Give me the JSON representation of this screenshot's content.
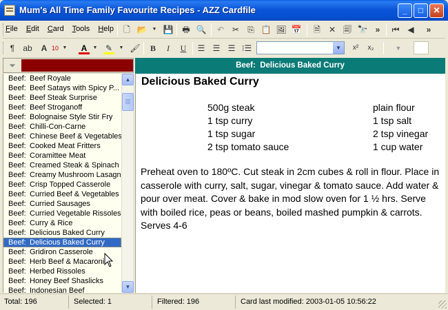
{
  "window": {
    "title": "Mum's All Time Family Favourite Recipes - AZZ Cardfile"
  },
  "menu": [
    "File",
    "Edit",
    "Card",
    "Tools",
    "Help"
  ],
  "toolbar": {
    "font_size": "10",
    "overflow": "»"
  },
  "list": {
    "items": [
      {
        "cat": "Beef:",
        "name": "Beef Royale"
      },
      {
        "cat": "Beef:",
        "name": "Beef Satays with Spicy P..."
      },
      {
        "cat": "Beef:",
        "name": "Beef Steak Surprise"
      },
      {
        "cat": "Beef:",
        "name": "Beef Stroganoff"
      },
      {
        "cat": "Beef:",
        "name": "Bolognaise Style Stir Fry"
      },
      {
        "cat": "Beef:",
        "name": "Chilli-Con-Carne"
      },
      {
        "cat": "Beef:",
        "name": "Chinese Beef & Vegetables"
      },
      {
        "cat": "Beef:",
        "name": "Cooked Meat Fritters"
      },
      {
        "cat": "Beef:",
        "name": "Coramittee Meat"
      },
      {
        "cat": "Beef:",
        "name": "Creamed Steak & Spinach"
      },
      {
        "cat": "Beef:",
        "name": "Creamy Mushroom Lasagne"
      },
      {
        "cat": "Beef:",
        "name": "Crisp Topped Casserole"
      },
      {
        "cat": "Beef:",
        "name": "Curried Beef & Vegetables"
      },
      {
        "cat": "Beef:",
        "name": "Curried Sausages"
      },
      {
        "cat": "Beef:",
        "name": "Curried Vegetable Rissoles"
      },
      {
        "cat": "Beef:",
        "name": "Curry & Rice"
      },
      {
        "cat": "Beef:",
        "name": "Delicious Baked Curry"
      },
      {
        "cat": "Beef:",
        "name": "Delicious Baked Curry"
      },
      {
        "cat": "Beef:",
        "name": "Gridiron Casserole"
      },
      {
        "cat": "Beef:",
        "name": "Herb Beef & Macaroni"
      },
      {
        "cat": "Beef:",
        "name": "Herbed Rissoles"
      },
      {
        "cat": "Beef:",
        "name": "Honey Beef Shaslicks"
      },
      {
        "cat": "Beef:",
        "name": "Indonesian Beef"
      }
    ],
    "selected_index": 17
  },
  "card": {
    "header": "Beef:  Delicious Baked Curry",
    "title": "Delicious Baked Curry",
    "ingredients_left": [
      "500g steak",
      "1 tsp curry",
      "1 tsp sugar",
      "2 tsp tomato sauce"
    ],
    "ingredients_right": [
      "plain flour",
      "1 tsp salt",
      "2 tsp vinegar",
      "1 cup water"
    ],
    "method": "Preheat oven to 180ºC.  Cut steak in 2cm cubes & roll in flour.  Place in casserole with curry, salt, sugar, vinegar & tomato sauce.  Add water & pour over meat.  Cover & bake in mod slow oven for 1 ½ hrs.  Serve with boiled rice, peas or beans, boiled mashed pumpkin & carrots. Serves 4-6"
  },
  "status": {
    "total": "Total: 196",
    "selected": "Selected: 1",
    "filtered": "Filtered: 196",
    "modified": "Card last modified: 2003-01-05  10:56:22"
  },
  "colors": {
    "title_bar": "#0b56d8",
    "selection": "#316ac5",
    "header": "#0b7b78",
    "filter": "#8b0000",
    "list_bg": "#fffff0"
  }
}
